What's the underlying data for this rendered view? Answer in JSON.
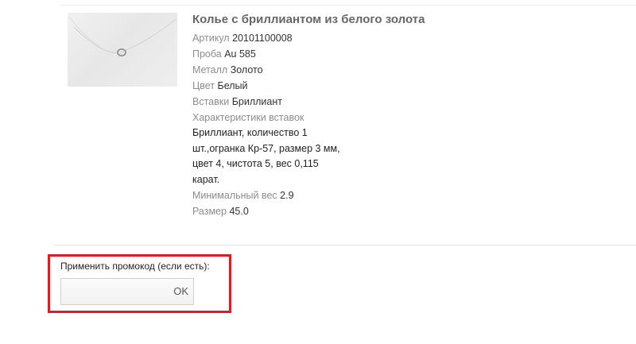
{
  "product": {
    "title": "Колье с бриллиантом из белого золота",
    "attributes": [
      {
        "key": "Артикул",
        "value": "20101100008"
      },
      {
        "key": "Проба",
        "value": "Au 585"
      },
      {
        "key": "Металл",
        "value": "Золото"
      },
      {
        "key": "Цвет",
        "value": "Белый"
      },
      {
        "key": "Вставки",
        "value": "Бриллиант"
      }
    ],
    "inserts_characteristics_label": "Характеристики вставок",
    "inserts_characteristics_lines": [
      "Бриллиант, количество 1",
      "шт.,огранка Кр-57, размер 3 мм,",
      "цвет 4, чистота 5, вес 0,115",
      "карат."
    ],
    "min_weight": {
      "key": "Минимальный вес",
      "value": "2.9"
    },
    "size": {
      "key": "Размер",
      "value": "45.0"
    }
  },
  "promo": {
    "label": "Применить промокод (если есть):",
    "input_value": "",
    "placeholder": "",
    "ok_label": "OK",
    "highlight_color": "#e11b22"
  }
}
